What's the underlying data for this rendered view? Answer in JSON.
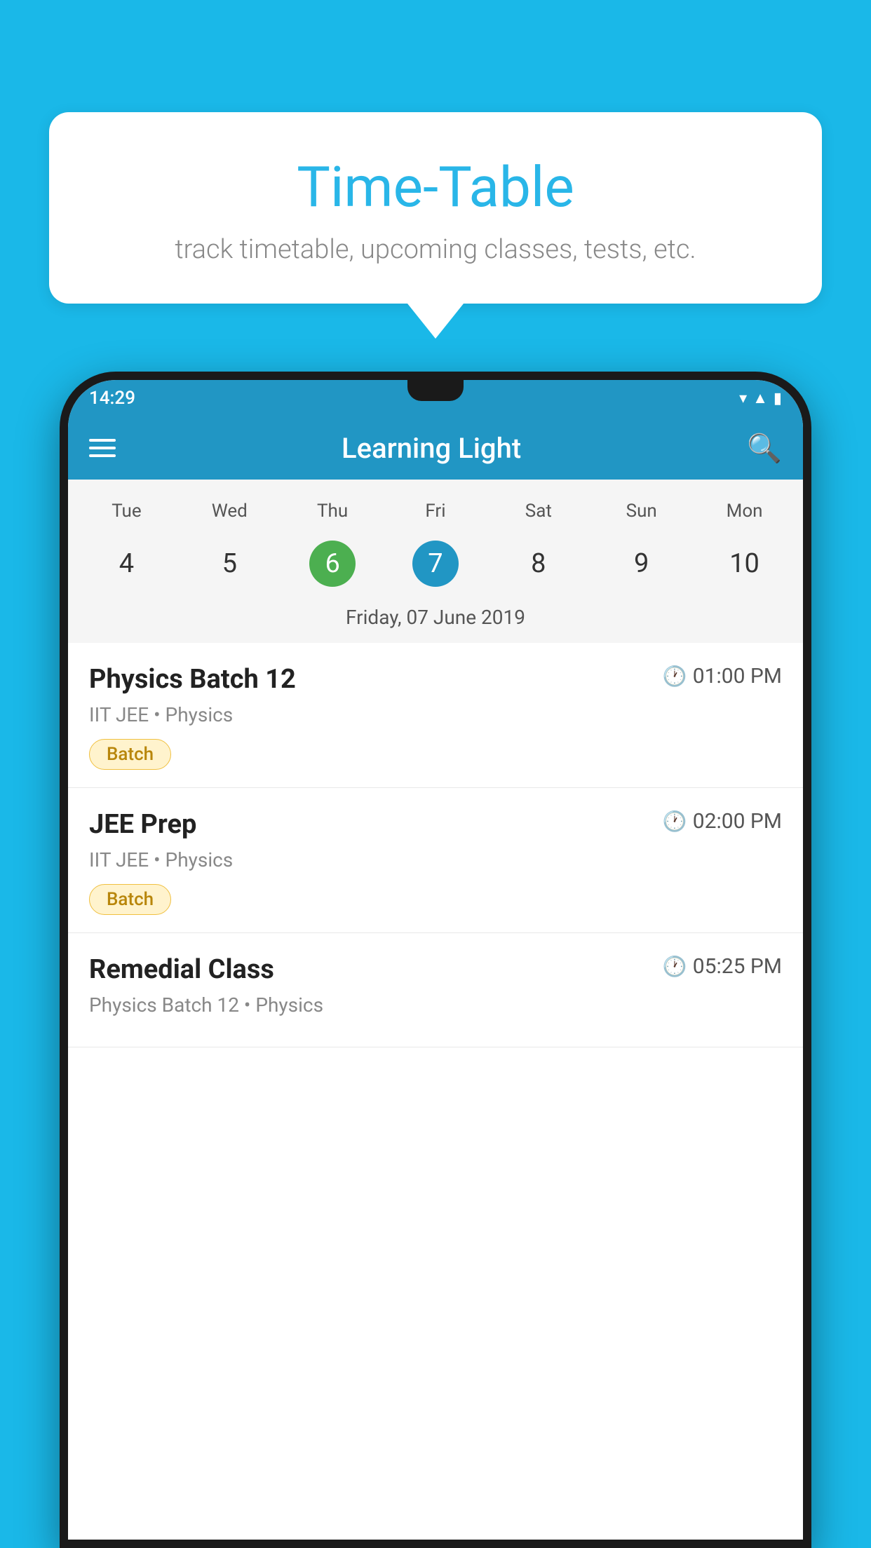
{
  "background_color": "#1ab8e8",
  "speech_bubble": {
    "title": "Time-Table",
    "subtitle": "track timetable, upcoming classes, tests, etc."
  },
  "status_bar": {
    "time": "14:29",
    "icons": [
      "wifi",
      "signal",
      "battery"
    ]
  },
  "app_bar": {
    "title": "Learning Light"
  },
  "calendar": {
    "day_labels": [
      "Tue",
      "Wed",
      "Thu",
      "Fri",
      "Sat",
      "Sun",
      "Mon"
    ],
    "day_numbers": [
      "4",
      "5",
      "6",
      "7",
      "8",
      "9",
      "10"
    ],
    "selected_today": "6",
    "selected_current": "7",
    "date_label": "Friday, 07 June 2019"
  },
  "schedule": [
    {
      "title": "Physics Batch 12",
      "time": "01:00 PM",
      "meta": "IIT JEE • Physics",
      "badge": "Batch"
    },
    {
      "title": "JEE Prep",
      "time": "02:00 PM",
      "meta": "IIT JEE • Physics",
      "badge": "Batch"
    },
    {
      "title": "Remedial Class",
      "time": "05:25 PM",
      "meta": "Physics Batch 12 • Physics",
      "badge": null
    }
  ],
  "icons": {
    "menu": "≡",
    "search": "🔍",
    "clock": "🕐"
  }
}
